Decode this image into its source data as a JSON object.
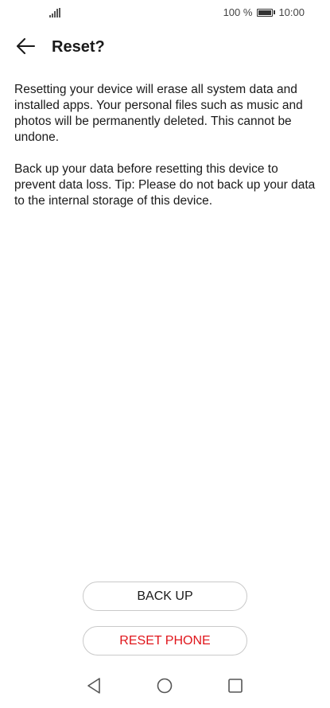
{
  "status_bar": {
    "signal_icon": "signal-bars-icon",
    "battery_percent": "100 %",
    "battery_icon": "battery-full-icon",
    "time": "10:00"
  },
  "header": {
    "back_icon": "arrow-left-icon",
    "title": "Reset?"
  },
  "content": {
    "paragraph_1": "Resetting your device will erase all system data and installed apps. Your personal files such as music and photos will be permanently deleted. This cannot be undone.",
    "paragraph_2": "Back up your data before resetting this device to prevent data loss. Tip: Please do not back up your data to the internal storage of this device."
  },
  "buttons": {
    "backup_label": "BACK UP",
    "reset_label": "RESET PHONE"
  },
  "colors": {
    "danger": "#e0151b",
    "button_border": "#c9c9c9"
  },
  "nav_bar": {
    "back_icon": "triangle-back-icon",
    "home_icon": "circle-home-icon",
    "recents_icon": "square-recents-icon"
  }
}
